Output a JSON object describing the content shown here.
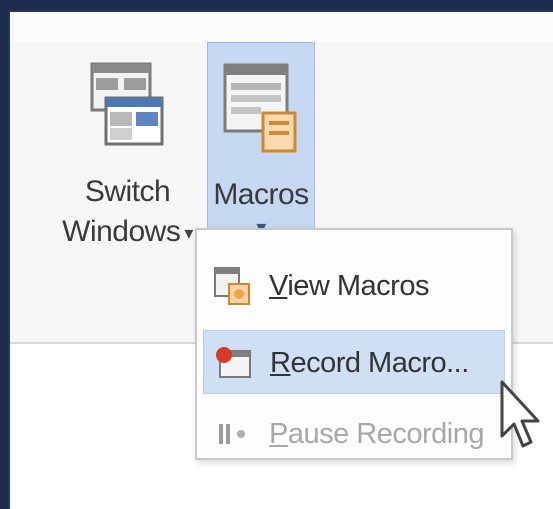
{
  "ribbon": {
    "switch_windows": {
      "line1": "Switch",
      "line2": "Windows",
      "caret": "▾",
      "icon": "switch-windows-icon"
    },
    "macros": {
      "label": "Macros",
      "caret": "▾",
      "icon": "macros-icon",
      "state": "pressed"
    }
  },
  "macros_menu": {
    "items": [
      {
        "accel": "V",
        "rest": "iew Macros",
        "icon": "view-macros-icon",
        "enabled": true
      },
      {
        "accel": "R",
        "rest": "ecord Macro...",
        "icon": "record-macro-icon",
        "enabled": true,
        "highlighted": true
      },
      {
        "accel": "P",
        "rest": "ause Recording",
        "icon": "pause-recording-icon",
        "enabled": false
      }
    ]
  },
  "colors": {
    "frame_border": "#1b2a4d",
    "pressed_button": "#c5d8f1",
    "hover_item": "#cfe0f4",
    "disabled_text": "#a8a8a8"
  }
}
